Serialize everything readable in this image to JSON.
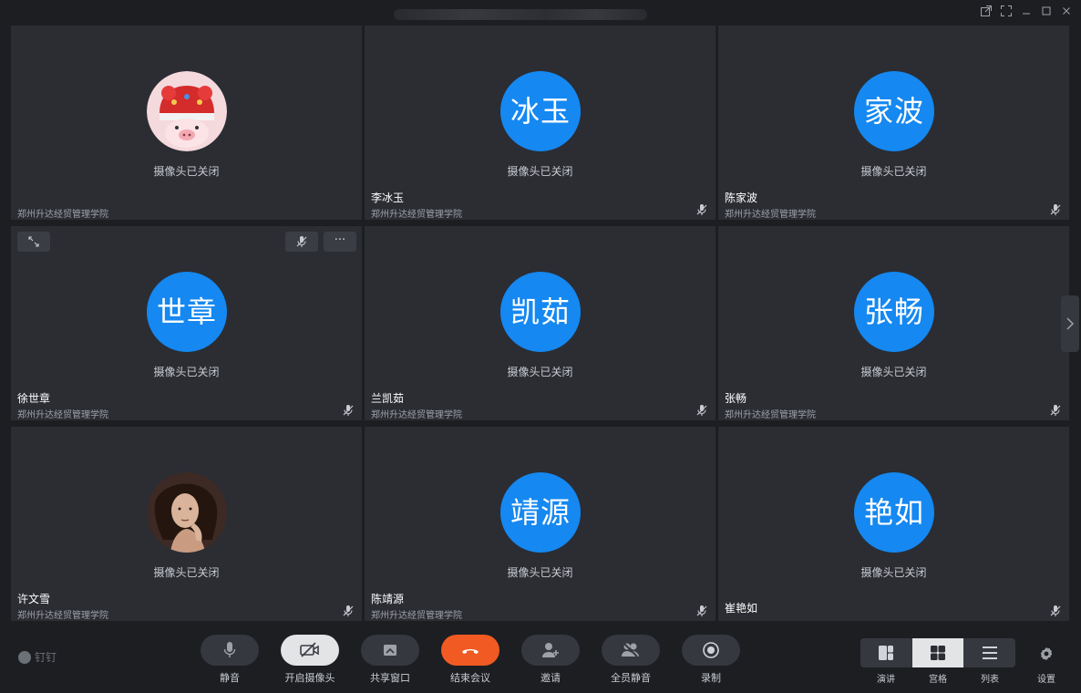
{
  "window": {
    "controls": [
      "popout-icon",
      "fullscreen-icon",
      "minimize-icon",
      "maximize-icon",
      "close-icon"
    ]
  },
  "participants": [
    {
      "avatar_text": "",
      "avatar_type": "photo-pig",
      "status": "摄像头已关闭",
      "name": "",
      "org": "郑州升达经贸管理学院",
      "muted": false
    },
    {
      "avatar_text": "冰玉",
      "avatar_type": "initials",
      "status": "摄像头已关闭",
      "name": "李冰玉",
      "org": "郑州升达经贸管理学院",
      "muted": true
    },
    {
      "avatar_text": "家波",
      "avatar_type": "initials",
      "status": "摄像头已关闭",
      "name": "陈家波",
      "org": "郑州升达经贸管理学院",
      "muted": true
    },
    {
      "avatar_text": "世章",
      "avatar_type": "initials",
      "status": "摄像头已关闭",
      "name": "徐世章",
      "org": "郑州升达经贸管理学院",
      "muted": true
    },
    {
      "avatar_text": "凯茹",
      "avatar_type": "initials",
      "status": "摄像头已关闭",
      "name": "兰凯茹",
      "org": "郑州升达经贸管理学院",
      "muted": true
    },
    {
      "avatar_text": "张畅",
      "avatar_type": "initials",
      "status": "摄像头已关闭",
      "name": "张畅",
      "org": "郑州升达经贸管理学院",
      "muted": true
    },
    {
      "avatar_text": "",
      "avatar_type": "photo-woman",
      "status": "摄像头已关闭",
      "name": "许文雪",
      "org": "郑州升达经贸管理学院",
      "muted": true
    },
    {
      "avatar_text": "靖源",
      "avatar_type": "initials",
      "status": "摄像头已关闭",
      "name": "陈靖源",
      "org": "郑州升达经贸管理学院",
      "muted": true
    },
    {
      "avatar_text": "艳如",
      "avatar_type": "initials",
      "status": "摄像头已关闭",
      "name": "崔艳如",
      "org": "",
      "muted": true
    }
  ],
  "tile_controls": {
    "expand": "expand-icon",
    "mute": "mic-off-icon",
    "more": "···"
  },
  "toolbar": {
    "brand": "钉钉",
    "buttons": [
      {
        "id": "mute",
        "label": "静音",
        "icon": "mic-icon"
      },
      {
        "id": "camera",
        "label": "开启摄像头",
        "icon": "camera-off-icon"
      },
      {
        "id": "share",
        "label": "共享窗口",
        "icon": "share-icon"
      },
      {
        "id": "end",
        "label": "结束会议",
        "icon": "hangup-icon"
      },
      {
        "id": "invite",
        "label": "邀请",
        "icon": "add-user-icon"
      },
      {
        "id": "mute-all",
        "label": "全员静音",
        "icon": "mute-all-icon"
      },
      {
        "id": "record",
        "label": "录制",
        "icon": "record-icon"
      }
    ],
    "views": [
      {
        "id": "speaker",
        "label": "演讲",
        "active": false
      },
      {
        "id": "grid",
        "label": "宫格",
        "active": true
      },
      {
        "id": "list",
        "label": "列表",
        "active": false
      }
    ],
    "settings_label": "设置"
  },
  "colors": {
    "avatar_blue": "#1588f1",
    "end_red": "#f15a22",
    "tile_bg": "#2b2d33",
    "window_bg": "#1c1e22"
  }
}
